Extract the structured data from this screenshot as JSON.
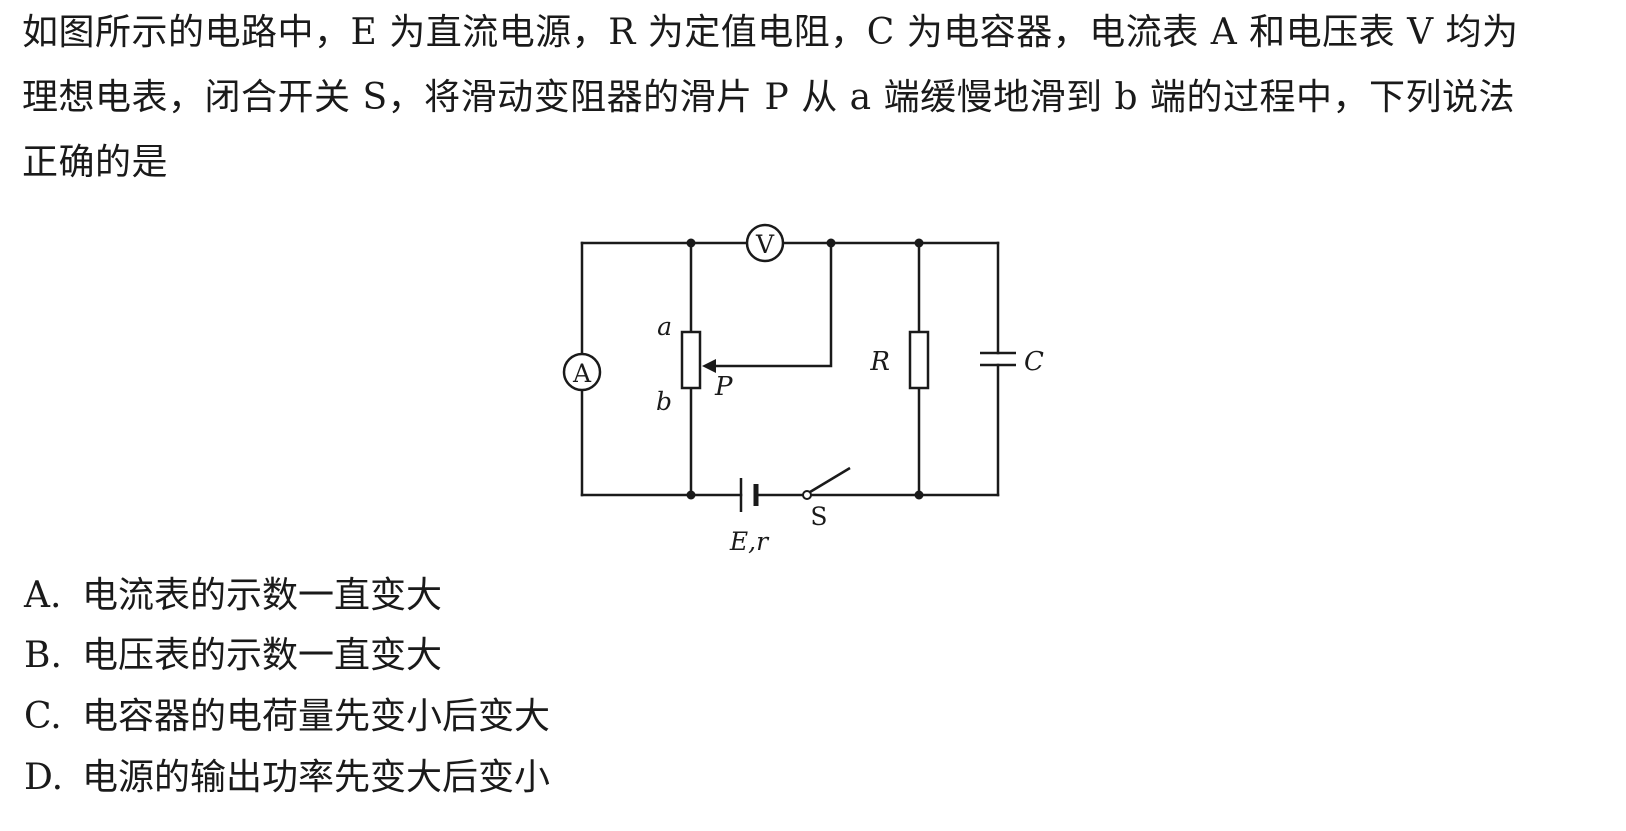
{
  "question": {
    "lines": [
      "如图所示的电路中，E 为直流电源，R 为定值电阻，C 为电容器，电流表 A 和电压表 V 均为",
      "理想电表，闭合开关 S，将滑动变阻器的滑片 P 从 a 端缓慢地滑到 b 端的过程中，下列说法",
      "正确的是"
    ]
  },
  "circuit": {
    "labels": {
      "voltmeter": "V",
      "ammeter": "A",
      "rheostat_a": "a",
      "rheostat_b": "b",
      "slider": "P",
      "resistor": "R",
      "capacitor": "C",
      "source": "E,r",
      "switch": "S"
    }
  },
  "options": [
    {
      "letter": "A.",
      "text": "电流表的示数一直变大"
    },
    {
      "letter": "B.",
      "text": "电压表的示数一直变大"
    },
    {
      "letter": "C.",
      "text": "电容器的电荷量先变小后变大"
    },
    {
      "letter": "D.",
      "text": "电源的输出功率先变大后变小"
    }
  ]
}
